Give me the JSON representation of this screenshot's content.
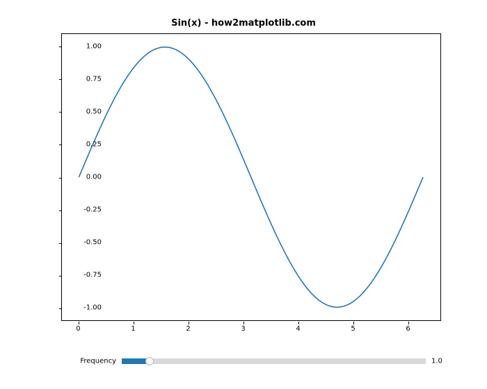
{
  "chart_data": {
    "type": "line",
    "title": "Sin(x) - how2matplotlib.com",
    "xlabel": "",
    "ylabel": "",
    "xlim": [
      -0.31,
      6.6
    ],
    "ylim": [
      -1.1,
      1.1
    ],
    "x_ticks": [
      0,
      1,
      2,
      3,
      4,
      5,
      6
    ],
    "x_tick_labels": [
      "0",
      "1",
      "2",
      "3",
      "4",
      "5",
      "6"
    ],
    "y_ticks": [
      -1.0,
      -0.75,
      -0.5,
      -0.25,
      0.0,
      0.25,
      0.5,
      0.75,
      1.0
    ],
    "y_tick_labels": [
      "-1.00",
      "-0.75",
      "-0.50",
      "-0.25",
      "0.00",
      "0.25",
      "0.50",
      "0.75",
      "1.00"
    ],
    "series": [
      {
        "name": "sin(x)",
        "color": "#1f77b4",
        "function": "y = sin(frequency * x)",
        "frequency": 1.0,
        "x_domain": [
          0,
          6.283185307179586
        ],
        "n_points": 100
      }
    ]
  },
  "slider": {
    "label": "Frequency",
    "min": 0.1,
    "max": 10.0,
    "value": 1.0,
    "value_text": "1.0"
  }
}
